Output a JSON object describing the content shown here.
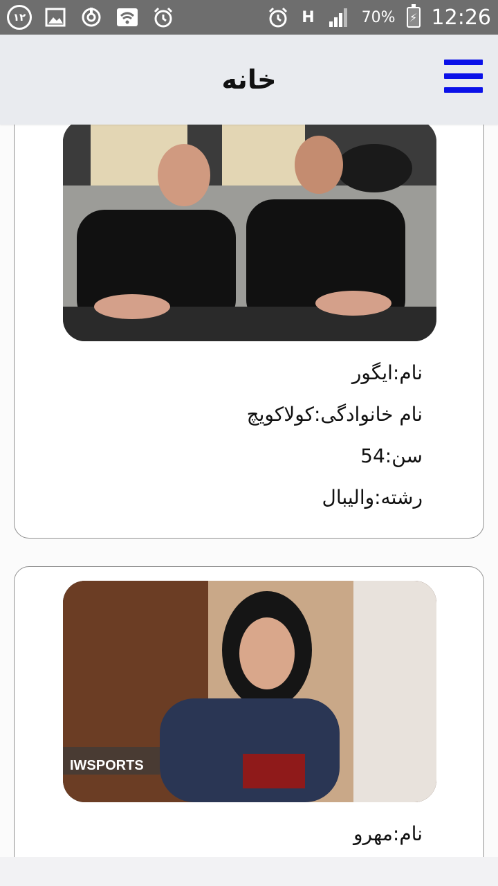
{
  "status_bar": {
    "notification_count": "۱۲",
    "battery_percent": "70%",
    "time": "12:26",
    "network_type": "H",
    "icons": [
      "notification-count-badge",
      "gallery-icon",
      "sync-icon",
      "wifi-icon",
      "alarm-icon",
      "alarm-icon",
      "signal-icon",
      "battery-icon"
    ]
  },
  "app_bar": {
    "title": "خانه",
    "menu_icon": "hamburger-menu-icon",
    "accent_color": "#0b11e8"
  },
  "people": [
    {
      "name_line": "نام:ایگور",
      "family_line": "نام خانوادگی:کولاکویچ",
      "age_line": "سن:54",
      "sport_line": "رشته:والیبال",
      "photo_icon": "person-photo"
    },
    {
      "name_line": "نام:مهرو",
      "photo_icon": "person-photo",
      "photo_watermark": "IWSPORTS"
    }
  ]
}
